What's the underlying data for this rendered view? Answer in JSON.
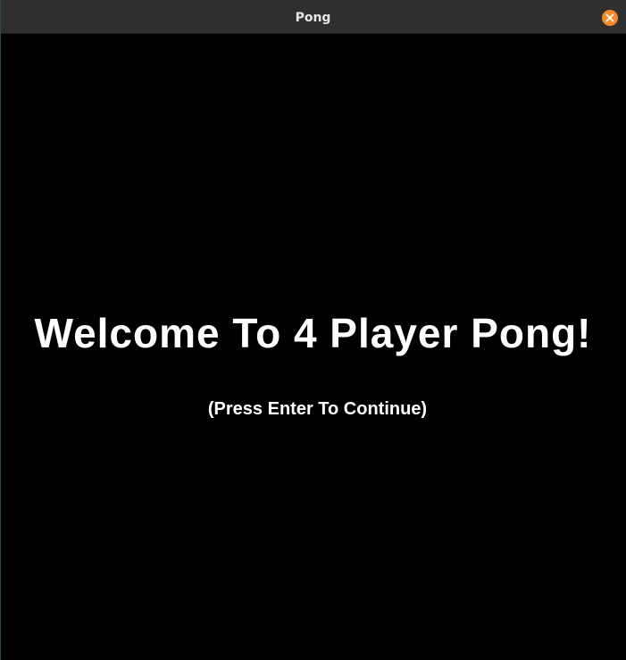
{
  "window": {
    "title": "Pong",
    "close_icon": "close-icon"
  },
  "game": {
    "heading": "Welcome To 4 Player Pong!",
    "prompt": "(Press Enter To Continue)"
  },
  "colors": {
    "background": "#000000",
    "titlebar": "#2f2f2f",
    "text": "#ffffff",
    "close_button": "#f08a2b"
  }
}
